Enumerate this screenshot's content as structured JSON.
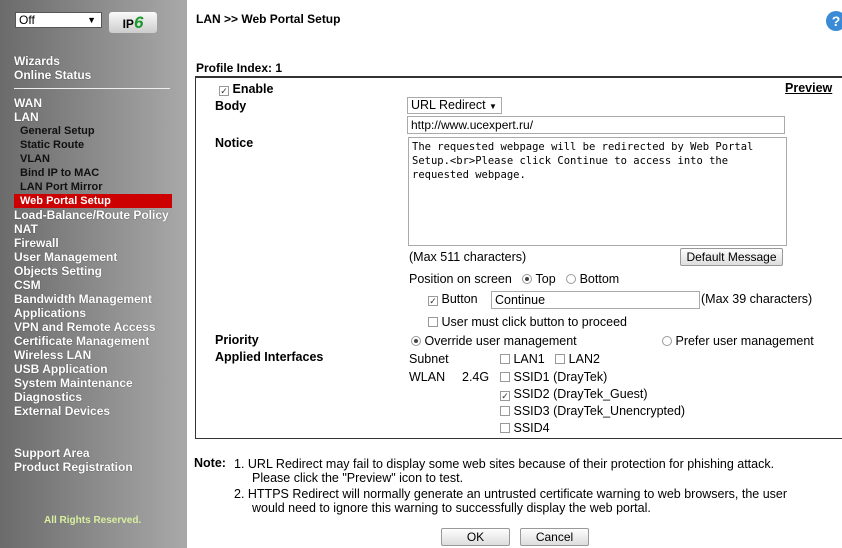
{
  "sidebar": {
    "mode_select": "Off",
    "ipv6_logo": "IPv6",
    "top": [
      "Wizards",
      "Online Status"
    ],
    "items": [
      "WAN",
      "LAN"
    ],
    "lan_sub": [
      "General Setup",
      "Static Route",
      "VLAN",
      "Bind IP to MAC",
      "LAN Port Mirror",
      "Web Portal Setup"
    ],
    "more": [
      "Load-Balance/Route Policy",
      "NAT",
      "Firewall",
      "User Management",
      "Objects Setting",
      "CSM",
      "Bandwidth Management",
      "Applications",
      "VPN and Remote Access",
      "Certificate Management",
      "Wireless LAN",
      "USB Application",
      "System Maintenance",
      "Diagnostics",
      "External Devices"
    ],
    "bottom": [
      "Support Area",
      "Product Registration"
    ],
    "footer": "All Rights Reserved."
  },
  "header": {
    "title": "LAN >> Web Portal Setup",
    "help": "?"
  },
  "form": {
    "profile": "Profile Index: 1",
    "enable": "Enable",
    "preview": "Preview",
    "body_label": "Body",
    "body_value": "URL Redirect",
    "url": "http://www.ucexpert.ru/",
    "notice_label": "Notice",
    "notice": "The requested webpage will be redirected by Web Portal Setup.<br>Please click Continue to access into the requested webpage.",
    "max511": "(Max 511 characters)",
    "default_msg": "Default Message",
    "position": "Position on screen",
    "top": "Top",
    "bottom": "Bottom",
    "button": "Button",
    "button_text": "Continue",
    "max39": "(Max 39 characters)",
    "must_click": "User must click button to proceed",
    "priority_label": "Priority",
    "override": "Override user management",
    "prefer": "Prefer user management",
    "applied_label": "Applied Interfaces",
    "subnet": "Subnet",
    "lan1": "LAN1",
    "lan2": "LAN2",
    "wlan": "WLAN",
    "band": "2.4G",
    "ssid1": "SSID1 (DrayTek)",
    "ssid2": "SSID2 (DrayTek_Guest)",
    "ssid3": "SSID3 (DrayTek_Unencrypted)",
    "ssid4": "SSID4"
  },
  "note": {
    "label": "Note:",
    "n1a": "1.  URL Redirect may fail to display some web sites because of their protection for phishing attack.",
    "n1b": "Please click the \"Preview\" icon to test.",
    "n2a": "2.  HTTPS Redirect will normally generate an untrusted certificate warning to web browsers, the user",
    "n2b": "would need to ignore this warning to successfully display the web portal."
  },
  "buttons": {
    "ok": "OK",
    "cancel": "Cancel"
  }
}
